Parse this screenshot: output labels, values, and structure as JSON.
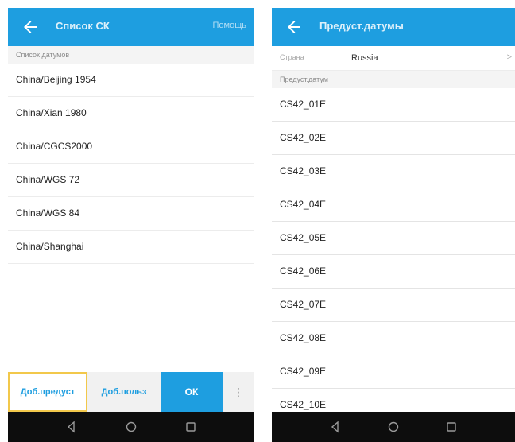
{
  "left_screen": {
    "title": "Список СК",
    "help": "Помощь",
    "section_header": "Список датумов",
    "items": [
      "China/Beijing 1954",
      "China/Xian 1980",
      "China/CGCS2000",
      "China/WGS 72",
      "China/WGS 84",
      "China/Shanghai"
    ],
    "buttons": {
      "add_preset": "Доб.предуст",
      "add_user": "Доб.польз",
      "ok": "ОК"
    }
  },
  "right_screen": {
    "title": "Предуст.датумы",
    "filter_label": "Страна",
    "filter_value": "Russia",
    "section_header": "Предуст.датум",
    "items": [
      "CS42_01E",
      "CS42_02E",
      "CS42_03E",
      "CS42_04E",
      "CS42_05E",
      "CS42_06E",
      "CS42_07E",
      "CS42_08E",
      "CS42_09E",
      "CS42_10E"
    ]
  },
  "colors": {
    "accent": "#1e9ee0",
    "highlight": "#f2c84b",
    "navbar": "#0d0d0d"
  },
  "icons": {
    "back": "arrow-left-icon",
    "more": "vertical-dots-icon",
    "chevron": "chevron-right-icon",
    "nav_back": "triangle-back-icon",
    "nav_home": "circle-home-icon",
    "nav_recent": "square-recent-icon"
  }
}
